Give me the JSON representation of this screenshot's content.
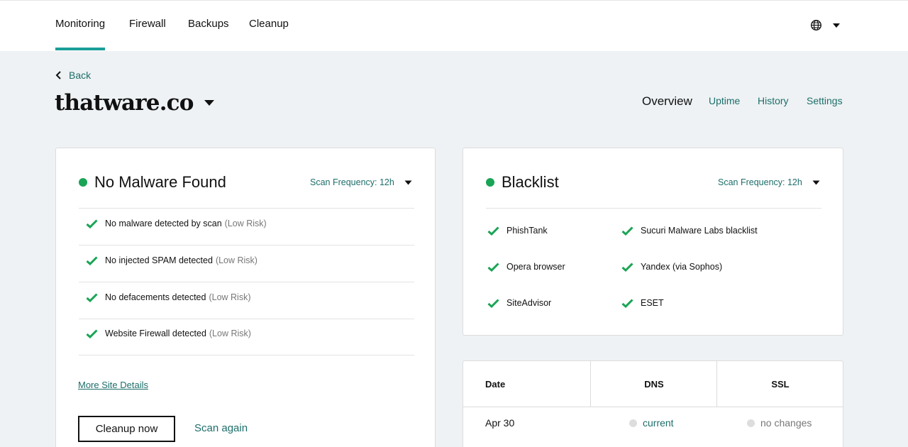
{
  "nav": {
    "tabs": [
      {
        "label": "Monitoring"
      },
      {
        "label": "Firewall"
      },
      {
        "label": "Backups"
      },
      {
        "label": "Cleanup"
      }
    ],
    "active_tab": "Monitoring"
  },
  "back": {
    "label": "Back"
  },
  "site": {
    "name": "thatware.co"
  },
  "subtabs": [
    {
      "label": "Overview"
    },
    {
      "label": "Uptime"
    },
    {
      "label": "History"
    },
    {
      "label": "Settings"
    }
  ],
  "malware": {
    "title": "No Malware Found",
    "frequency": "Scan Frequency: 12h",
    "status_color": "#1aa455",
    "items": [
      {
        "text": "No malware detected by scan",
        "risk": "(Low Risk)"
      },
      {
        "text": "No injected SPAM detected",
        "risk": "(Low Risk)"
      },
      {
        "text": "No defacements detected",
        "risk": "(Low Risk)"
      },
      {
        "text": "Website Firewall detected",
        "risk": "(Low Risk)"
      }
    ],
    "more_details": "More Site Details",
    "cleanup_button": "Cleanup now",
    "scan_again": "Scan again"
  },
  "blacklist": {
    "title": "Blacklist",
    "frequency": "Scan Frequency: 12h",
    "status_color": "#1aa455",
    "items": [
      {
        "text": "PhishTank"
      },
      {
        "text": "Sucuri Malware Labs blacklist"
      },
      {
        "text": "Opera browser"
      },
      {
        "text": "Yandex (via Sophos)"
      },
      {
        "text": "SiteAdvisor"
      },
      {
        "text": "ESET"
      }
    ]
  },
  "history_table": {
    "columns": [
      "Date",
      "DNS",
      "SSL"
    ],
    "rows": [
      {
        "date": "Apr 30",
        "dns": "current",
        "ssl": "no changes"
      }
    ]
  },
  "colors": {
    "accent": "#1a9e99",
    "link": "#1d6e6a",
    "check": "#1aa455",
    "background": "#eef2f4"
  },
  "icons": {
    "language": "globe-icon",
    "dropdown": "caret-down-icon",
    "back": "chevron-left-icon",
    "check": "check-icon"
  }
}
